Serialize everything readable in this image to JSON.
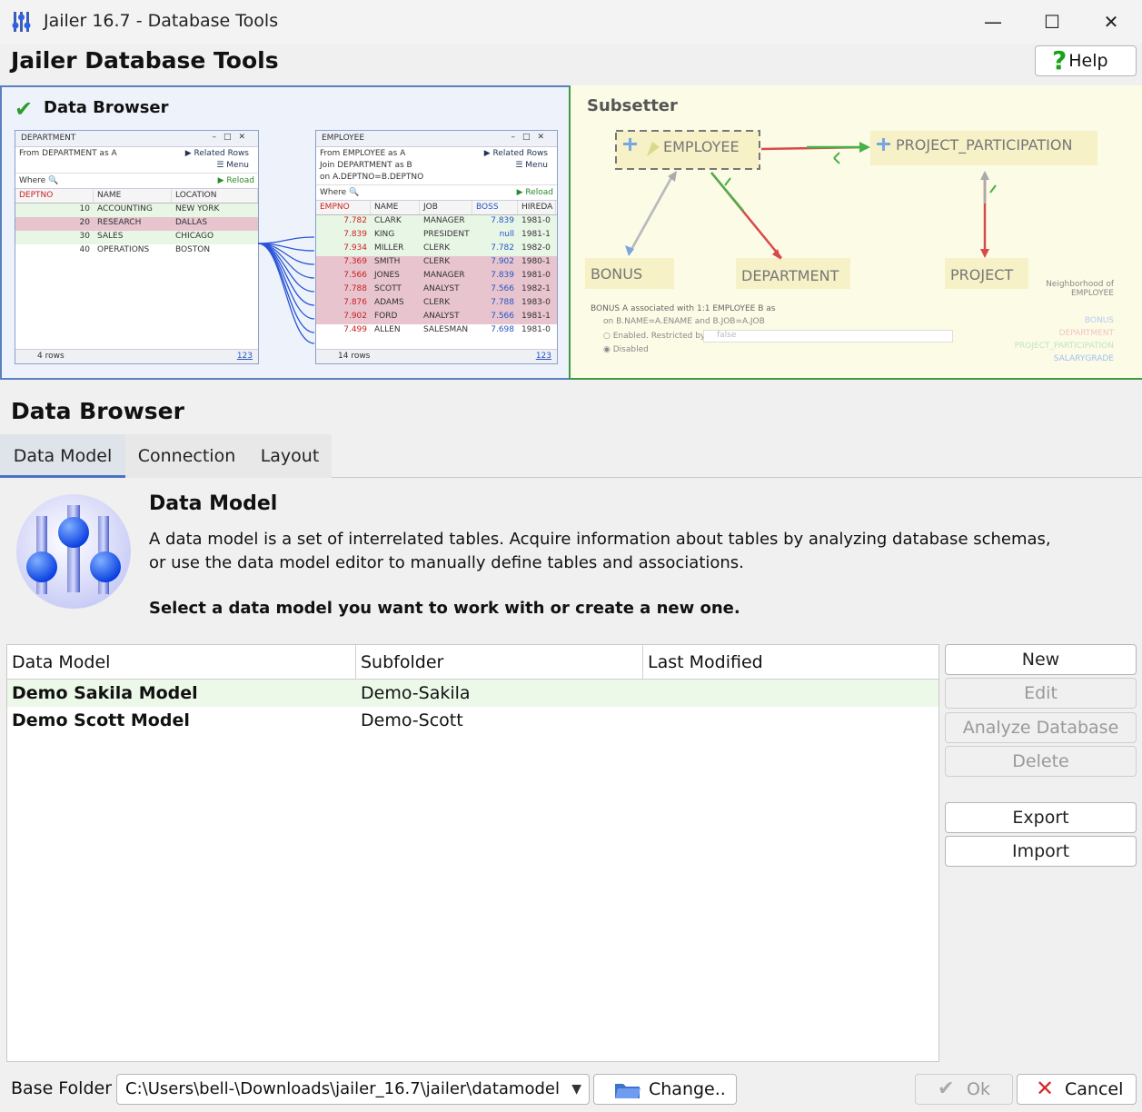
{
  "window": {
    "title": "Jailer 16.7 - Database Tools",
    "min": "—",
    "max": "☐",
    "close": "✕"
  },
  "header": {
    "title": "Jailer Database Tools",
    "help_label": "Help"
  },
  "banner": {
    "browser": {
      "title": "Data Browser",
      "department": {
        "win_title": "DEPARTMENT",
        "from_text": "From  DEPARTMENT  as A",
        "related": "Related Rows",
        "menu": "Menu",
        "where": "Where",
        "reload": "Reload",
        "columns": [
          "DEPTNO",
          "NAME",
          "LOCATION"
        ],
        "rows": [
          [
            "10",
            "ACCOUNTING",
            "NEW YORK"
          ],
          [
            "20",
            "RESEARCH",
            "DALLAS"
          ],
          [
            "30",
            "SALES",
            "CHICAGO"
          ],
          [
            "40",
            "OPERATIONS",
            "BOSTON"
          ]
        ],
        "footer": "4 rows",
        "footer_link": "123"
      },
      "employee": {
        "win_title": "EMPLOYEE",
        "from_text": "From  EMPLOYEE  as A",
        "join_text": "Join  DEPARTMENT  as B",
        "on_text": "on  A.DEPTNO=B.DEPTNO",
        "related": "Related Rows",
        "menu": "Menu",
        "where": "Where",
        "reload": "Reload",
        "columns": [
          "EMPNO",
          "NAME",
          "JOB",
          "BOSS",
          "HIREDA"
        ],
        "rows": [
          [
            "7.782",
            "CLARK",
            "MANAGER",
            "7.839",
            "1981-0"
          ],
          [
            "7.839",
            "KING",
            "PRESIDENT",
            "null",
            "1981-1"
          ],
          [
            "7.934",
            "MILLER",
            "CLERK",
            "7.782",
            "1982-0"
          ],
          [
            "7.369",
            "SMITH",
            "CLERK",
            "7.902",
            "1980-1"
          ],
          [
            "7.566",
            "JONES",
            "MANAGER",
            "7.839",
            "1981-0"
          ],
          [
            "7.788",
            "SCOTT",
            "ANALYST",
            "7.566",
            "1982-1"
          ],
          [
            "7.876",
            "ADAMS",
            "CLERK",
            "7.788",
            "1983-0"
          ],
          [
            "7.902",
            "FORD",
            "ANALYST",
            "7.566",
            "1981-1"
          ],
          [
            "7.499",
            "ALLEN",
            "SALESMAN",
            "7.698",
            "1981-0"
          ]
        ],
        "footer": "14 rows",
        "footer_link": "123"
      }
    },
    "subsetter": {
      "title": "Subsetter",
      "nodes": {
        "employee": "EMPLOYEE",
        "project_participation": "PROJECT_PARTICIPATION",
        "bonus": "BONUS",
        "department": "DEPARTMENT",
        "project": "PROJECT"
      },
      "neighborhood": "Neighborhood of EMPLOYEE",
      "assoc_line1": "BONUS A associated with 1:1 EMPLOYEE B as",
      "assoc_line2": "on B.NAME=A.ENAME and B.JOB=A.JOB",
      "enabled": "Enabled. Restricted by",
      "restrict_value": "false",
      "disabled": "Disabled",
      "legend": [
        "BONUS",
        "DEPARTMENT",
        "PROJECT_PARTICIPATION",
        "SALARYGRADE"
      ]
    }
  },
  "section": {
    "title": "Data Browser"
  },
  "tabs": [
    {
      "label": "Data Model"
    },
    {
      "label": "Connection"
    },
    {
      "label": "Layout"
    }
  ],
  "content": {
    "heading": "Data Model",
    "desc_line1": "A data model is a set of interrelated tables. Acquire information about tables by analyzing database schemas,",
    "desc_line2": "or use the data model editor to manually define tables and associations.",
    "prompt": "Select a data model you want to work with or create a new one.",
    "table": {
      "columns": [
        "Data Model",
        "Subfolder",
        "Last Modified"
      ],
      "rows": [
        [
          "Demo Sakila Model",
          "Demo-Sakila",
          ""
        ],
        [
          "Demo Scott Model",
          "Demo-Scott",
          ""
        ]
      ]
    },
    "buttons": {
      "new": "New",
      "edit": "Edit",
      "analyze": "Analyze Database",
      "delete": "Delete",
      "export": "Export",
      "import": "Import"
    }
  },
  "footer": {
    "base_label": "Base Folder",
    "base_path": "C:\\Users\\bell-\\Downloads\\jailer_16.7\\jailer\\datamodel",
    "change": "Change..",
    "ok": "Ok",
    "cancel": "Cancel"
  },
  "colors": {
    "accent": "#4a72c4",
    "selected_row": "#ecf9e9",
    "cancel_icon": "#d62b2b",
    "ok_icon": "#aaaaaa"
  }
}
